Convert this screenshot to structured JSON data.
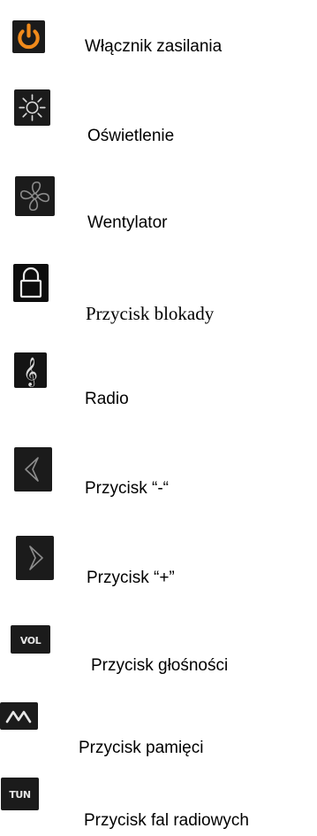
{
  "colors": {
    "icon_bg": "#1b1b1b",
    "power_orange": "#f08a1b",
    "icon_stroke": "#8c8c8c",
    "text": "#000000"
  },
  "items": [
    {
      "label": "Włącznik zasilania",
      "icon": "power-icon"
    },
    {
      "label": "Oświetlenie",
      "icon": "light-icon"
    },
    {
      "label": "Wentylator",
      "icon": "fan-icon"
    },
    {
      "label": "Przycisk blokady",
      "icon": "lock-icon"
    },
    {
      "label": "Radio",
      "icon": "treble-clef-icon"
    },
    {
      "label": "Przycisk “-“",
      "icon": "chevron-left-icon"
    },
    {
      "label": "Przycisk “+”",
      "icon": "chevron-right-icon"
    },
    {
      "label": "Przycisk głośności",
      "icon": "volume-icon",
      "icon_text": "VOL"
    },
    {
      "label": "Przycisk pamięci",
      "icon": "memory-icon"
    },
    {
      "label": "Przycisk fal radiowych",
      "icon": "tuner-icon",
      "icon_text": "TUN"
    }
  ]
}
